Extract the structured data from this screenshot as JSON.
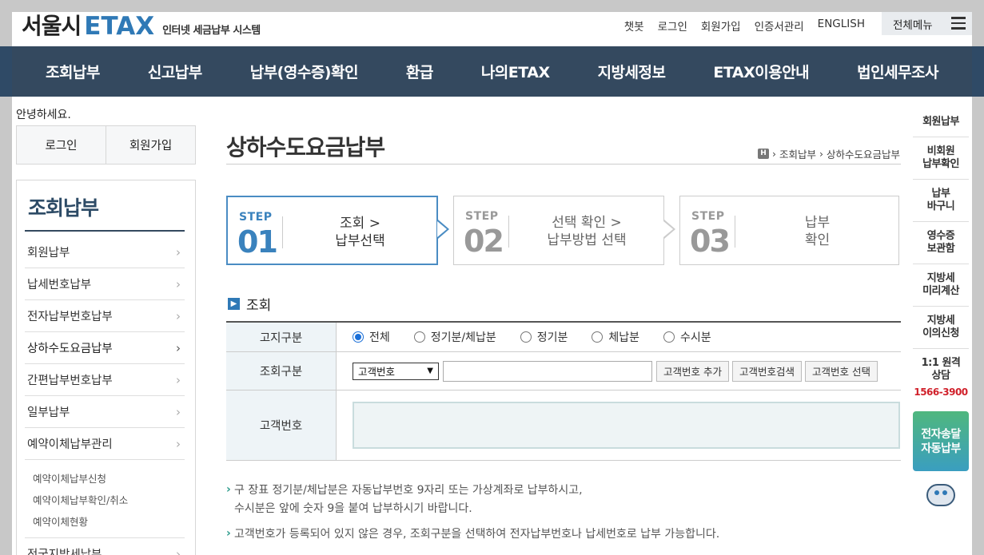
{
  "header": {
    "logo_main": "서울시",
    "logo_etax": "ETAX",
    "logo_sub": "인터넷 세금납부 시스템",
    "top_links": [
      "챗봇",
      "로그인",
      "회원가입",
      "인증서관리",
      "ENGLISH"
    ],
    "all_menu": "전체메뉴"
  },
  "nav": [
    "조회납부",
    "신고납부",
    "납부(영수증)확인",
    "환급",
    "나의ETAX",
    "지방세정보",
    "ETAX이용안내",
    "법인세무조사"
  ],
  "sidebar": {
    "greeting": "안녕하세요.",
    "login": "로그인",
    "join": "회원가입",
    "title": "조회납부",
    "items": [
      "회원납부",
      "납세번호납부",
      "전자납부번호납부",
      "상하수도요금납부",
      "간편납부번호납부",
      "일부납부",
      "예약이체납부관리"
    ],
    "sub_items": [
      "예약이체납부신청",
      "예약이체납부확인/취소",
      "예약이체현황"
    ],
    "last_item": "전국지방세납부"
  },
  "main": {
    "title": "상하수도요금납부",
    "breadcrumb_home": "H",
    "breadcrumb": [
      "조회납부",
      "상하수도요금납부"
    ],
    "steps": [
      {
        "label": "STEP",
        "num": "01",
        "line1": "조회 >",
        "line2": "납부선택"
      },
      {
        "label": "STEP",
        "num": "02",
        "line1": "선택 확인 >",
        "line2": "납부방법 선택"
      },
      {
        "label": "STEP",
        "num": "03",
        "line1": "납부",
        "line2": "확인"
      }
    ],
    "section_title": "조회",
    "form": {
      "row1_label": "고지구분",
      "radios": [
        "전체",
        "정기분/체납분",
        "정기분",
        "체납분",
        "수시분"
      ],
      "row2_label": "조회구분",
      "select_value": "고객번호",
      "buttons": [
        "고객번호 추가",
        "고객번호검색",
        "고객번호 선택"
      ],
      "row3_label": "고객번호"
    },
    "notes": [
      "구 장표 정기분/체납분은 자동납부번호 9자리 또는 가상계좌로 납부하시고,",
      "수시분은 앞에 숫자 9을 붙여 납부하시기 바랍니다.",
      "고객번호가 등록되어 있지 않은 경우, 조회구분을 선택하여 전자납부번호나 납세번호로 납부 가능합니다."
    ]
  },
  "quick": {
    "items": [
      {
        "l1": "회원납부",
        "l2": ""
      },
      {
        "l1": "비회원",
        "l2": "납부확인"
      },
      {
        "l1": "납부",
        "l2": "바구니"
      },
      {
        "l1": "영수증",
        "l2": "보관함"
      },
      {
        "l1": "지방세",
        "l2": "미리계산"
      },
      {
        "l1": "지방세",
        "l2": "이의신청"
      }
    ],
    "counsel_l1": "1:1 원격",
    "counsel_l2": "상담",
    "phone": "1566-3900",
    "green_l1": "전자송달",
    "green_l2": "자동납부"
  }
}
